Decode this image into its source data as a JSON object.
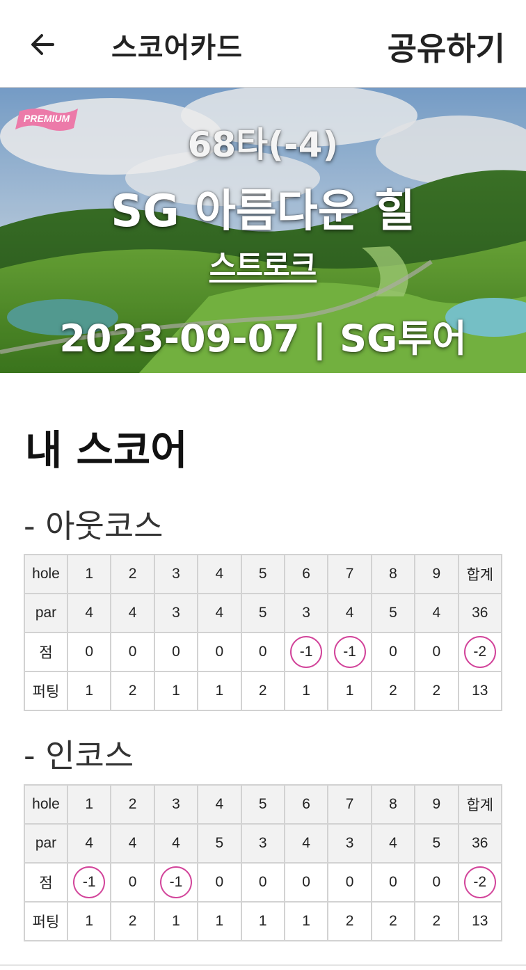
{
  "header": {
    "back_icon": "arrow-left-icon",
    "title": "스코어카드",
    "share_label": "공유하기"
  },
  "hero": {
    "badge": "PREMIUM",
    "score": "68타(-4)",
    "course_name": "SG 아름다운 힐",
    "game_type": "스트로크",
    "date_tour": "2023-09-07 | SG투어"
  },
  "my_score": {
    "title": "내 스코어",
    "highlight_color": "#d2449a",
    "out_course": {
      "title": "- 아웃코스",
      "header": [
        "hole",
        "1",
        "2",
        "3",
        "4",
        "5",
        "6",
        "7",
        "8",
        "9",
        "합계"
      ],
      "par": [
        "par",
        "4",
        "4",
        "3",
        "4",
        "5",
        "3",
        "4",
        "5",
        "4",
        "36"
      ],
      "score": [
        "점",
        "0",
        "0",
        "0",
        "0",
        "0",
        "-1",
        "-1",
        "0",
        "0",
        "-2"
      ],
      "putting": [
        "퍼팅",
        "1",
        "2",
        "1",
        "1",
        "2",
        "1",
        "1",
        "2",
        "2",
        "13"
      ]
    },
    "in_course": {
      "title": "- 인코스",
      "header": [
        "hole",
        "1",
        "2",
        "3",
        "4",
        "5",
        "6",
        "7",
        "8",
        "9",
        "합계"
      ],
      "par": [
        "par",
        "4",
        "4",
        "4",
        "5",
        "3",
        "4",
        "3",
        "4",
        "5",
        "36"
      ],
      "score": [
        "점",
        "-1",
        "0",
        "-1",
        "0",
        "0",
        "0",
        "0",
        "0",
        "0",
        "-2"
      ],
      "putting": [
        "퍼팅",
        "1",
        "2",
        "1",
        "1",
        "1",
        "1",
        "2",
        "2",
        "2",
        "13"
      ]
    }
  }
}
